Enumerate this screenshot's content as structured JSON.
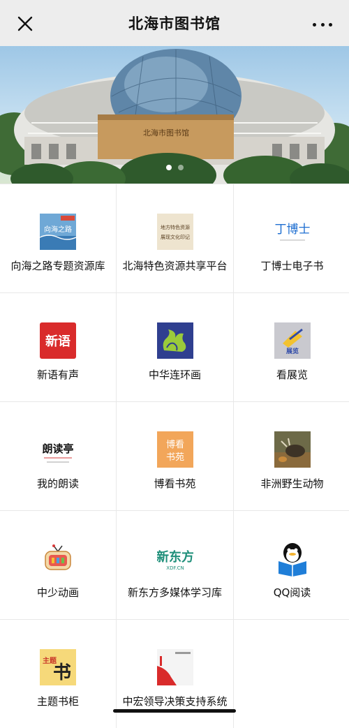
{
  "nav": {
    "title": "北海市图书馆",
    "close_icon": "close-icon",
    "more_icon": "more-icon"
  },
  "banner": {
    "building_sign": "北海市图书馆",
    "slides": 2,
    "active_slide": 1
  },
  "grid": [
    {
      "label": "向海之路专题资源库",
      "icon": "sea-road-icon",
      "icon_text": "向海之路"
    },
    {
      "label": "北海特色资源共享平台",
      "icon": "local-resources-icon",
      "icon_text": "地方特色资源 展现文化印记"
    },
    {
      "label": "丁博士电子书",
      "icon": "dr-ding-icon",
      "icon_text": "丁博士"
    },
    {
      "label": "新语有声",
      "icon": "xinyu-icon",
      "icon_text": "新语"
    },
    {
      "label": "中华连环画",
      "icon": "comic-icon",
      "icon_text": ""
    },
    {
      "label": "看展览",
      "icon": "exhibition-icon",
      "icon_text": "展览"
    },
    {
      "label": "我的朗读",
      "icon": "reading-icon",
      "icon_text": "朗读亭"
    },
    {
      "label": "博看书苑",
      "icon": "bookan-icon",
      "icon_text": "博看 书苑"
    },
    {
      "label": "非洲野生动物",
      "icon": "wildlife-icon",
      "icon_text": ""
    },
    {
      "label": "中少动画",
      "icon": "tv-animation-icon",
      "icon_text": ""
    },
    {
      "label": "新东方多媒体学习库",
      "icon": "xdf-icon",
      "icon_text": "新东方 XDF.CN"
    },
    {
      "label": "QQ阅读",
      "icon": "qq-reading-icon",
      "icon_text": ""
    },
    {
      "label": "主题书柜",
      "icon": "theme-bookcase-icon",
      "icon_text": "主题 书"
    },
    {
      "label": "中宏领导决策支持系统",
      "icon": "decision-system-icon",
      "icon_text": ""
    }
  ],
  "colors": {
    "nav_bg": "#ededed",
    "xinyu_red": "#d92b2b",
    "bookan_orange": "#f2a65a",
    "qq_blue": "#1f7ed8",
    "xdf_green": "#1f8f7a"
  }
}
